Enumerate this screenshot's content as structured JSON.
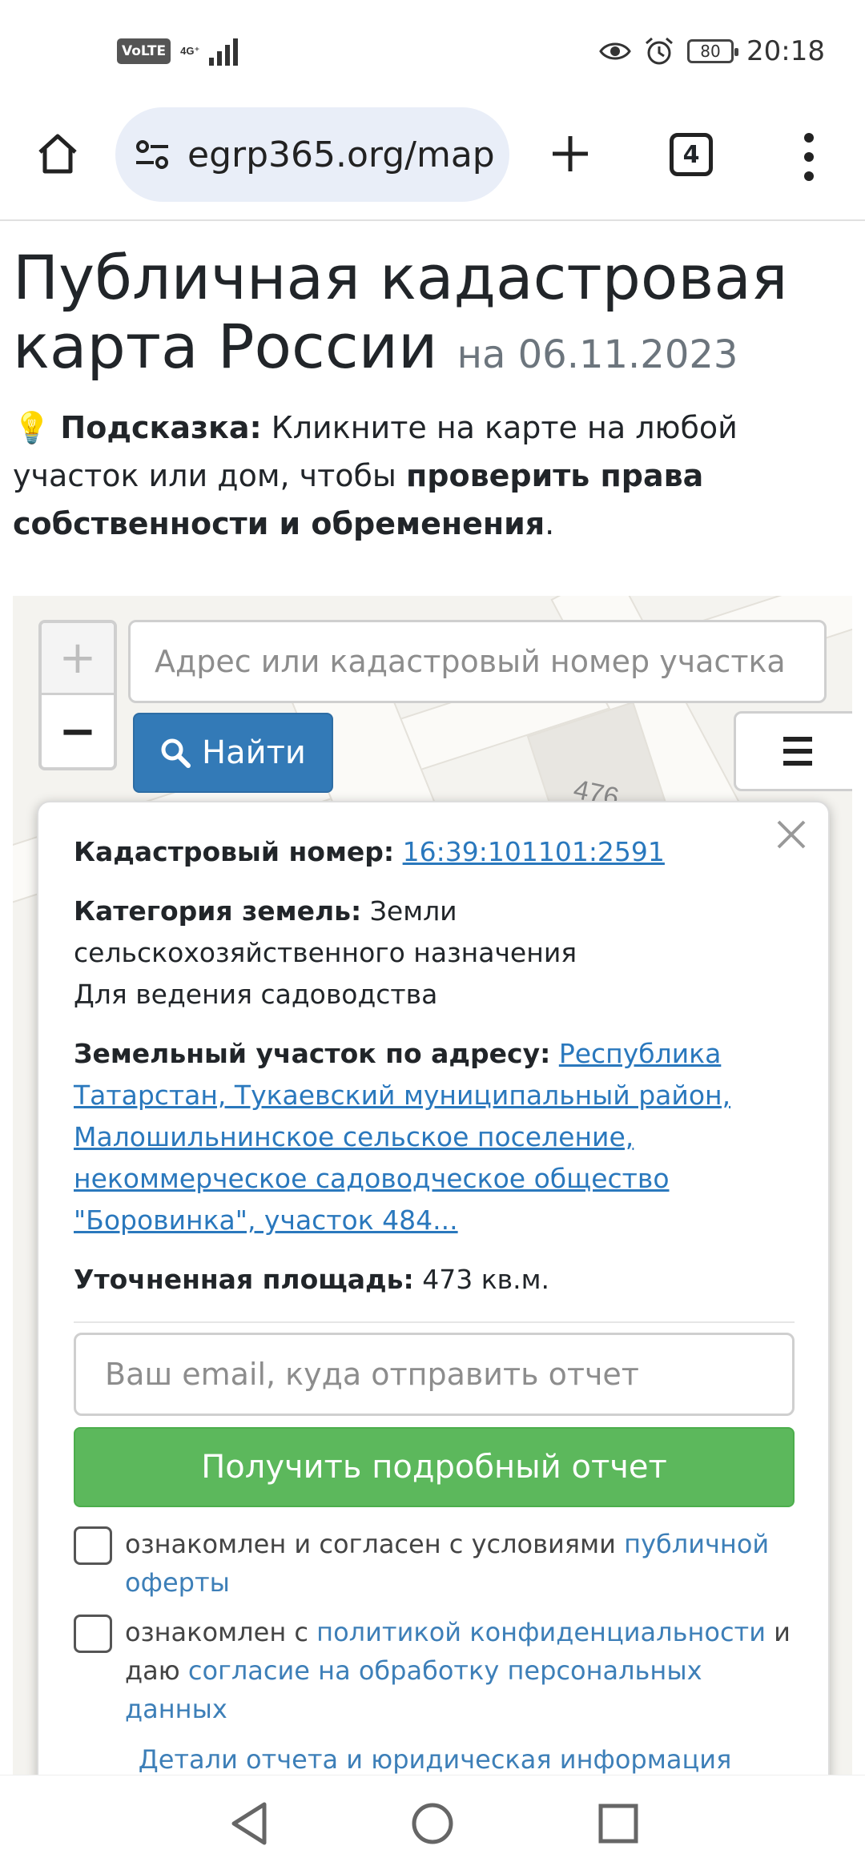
{
  "status_bar": {
    "volte": "VoLTE",
    "network": "4G⁺",
    "battery": "80",
    "time": "20:18"
  },
  "browser": {
    "url": "egrp365.org/map",
    "tab_count": "4"
  },
  "page": {
    "title": "Публичная кадастровая карта России",
    "title_date": "на 06.11.2023",
    "hint_icon": "💡",
    "hint_label": "Подсказка:",
    "hint_text_1": " Кликните на карте на любой участок или дом, чтобы ",
    "hint_bold": "проверить права собственности и обременения",
    "hint_end": "."
  },
  "map": {
    "zoom_in": "+",
    "zoom_out": "−",
    "search_placeholder": "Адрес или кадастровый номер участка",
    "find_label": "Найти",
    "plot_label": "476"
  },
  "popup": {
    "cadastral_label": "Кадастровый номер:",
    "cadastral_value": "16:39:101101:2591",
    "category_label": "Категория земель:",
    "category_value": "Земли сельскохозяйственного назначения",
    "usage": "Для ведения садоводства",
    "address_label": "Земельный участок по адресу:",
    "address_value": "Республика Татарстан, Тукаевский муниципальный район, Малошильнинское сельское поселение, некоммерческое садоводческое общество \"Боровинка\", участок 484...",
    "area_label": "Уточненная площадь:",
    "area_value": "473 кв.м.",
    "email_placeholder": "Ваш email, куда отправить отчет",
    "report_button": "Получить подробный отчет",
    "check1_text": "ознакомлен и согласен с условиями ",
    "check1_link": "публичной оферты",
    "check2_text1": "ознакомлен с ",
    "check2_link1": "политикой конфиденциальности",
    "check2_text2": " и даю ",
    "check2_link2": "согласие на обработку персональных данных",
    "details_link": "Детали отчета и юридическая информация"
  },
  "colors": {
    "primary": "#337ab7",
    "success": "#5cb85c",
    "link": "#2a78bd"
  }
}
